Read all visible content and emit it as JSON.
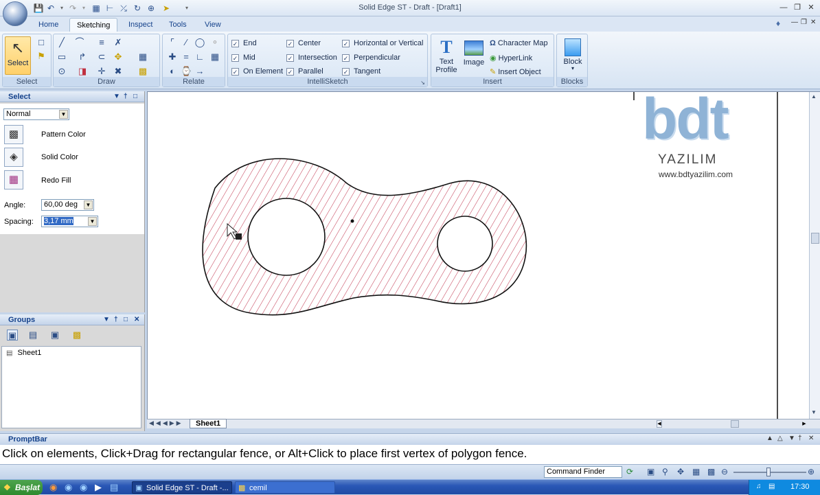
{
  "app": {
    "title": "Solid Edge ST - Draft - [Draft1]",
    "tabs": [
      "Home",
      "Sketching",
      "Inspect",
      "Tools",
      "View"
    ],
    "active_tab": "Sketching"
  },
  "ribbon": {
    "select": {
      "label": "Select",
      "group": "Select"
    },
    "draw": {
      "group": "Draw"
    },
    "relate": {
      "group": "Relate"
    },
    "intellisketch": {
      "group": "IntelliSketch",
      "options": [
        {
          "label": "End",
          "checked": true
        },
        {
          "label": "Mid",
          "checked": true
        },
        {
          "label": "On Element",
          "checked": true
        },
        {
          "label": "Center",
          "checked": true
        },
        {
          "label": "Intersection",
          "checked": true
        },
        {
          "label": "Parallel",
          "checked": true
        },
        {
          "label": "Horizontal or Vertical",
          "checked": true
        },
        {
          "label": "Perpendicular",
          "checked": true
        },
        {
          "label": "Tangent",
          "checked": true
        }
      ]
    },
    "insert": {
      "group": "Insert",
      "text_profile": "Text Profile",
      "image": "Image",
      "character_map": "Character Map",
      "hyperlink": "HyperLink",
      "insert_object": "Insert Object"
    },
    "blocks": {
      "group": "Blocks",
      "block": "Block"
    }
  },
  "select_pane": {
    "title": "Select",
    "mode": "Normal",
    "buttons": [
      "Pattern Color",
      "Solid Color",
      "Redo Fill"
    ],
    "angle_label": "Angle:",
    "angle_value": "60,00 deg",
    "spacing_label": "Spacing:",
    "spacing_value": "3,17 mm"
  },
  "groups_pane": {
    "title": "Groups",
    "items": [
      "Sheet1"
    ]
  },
  "watermark": {
    "logo": "bdt",
    "company": "YAZILIM",
    "url": "www.bdtyazilim.com"
  },
  "sheet_tab": "Sheet1",
  "prompt": {
    "title": "PromptBar",
    "text": "Click on elements, Click+Drag for rectangular fence, or Alt+Click to place first vertex of polygon fence."
  },
  "status": {
    "command_finder_placeholder": "Command Finder"
  },
  "taskbar": {
    "start": "Başlat",
    "items": [
      "Solid Edge ST - Draft -...",
      "cemil"
    ],
    "clock": "17:30"
  },
  "colors": {
    "hatch": "#c0304a",
    "ribbon_blue": "#15428b"
  }
}
